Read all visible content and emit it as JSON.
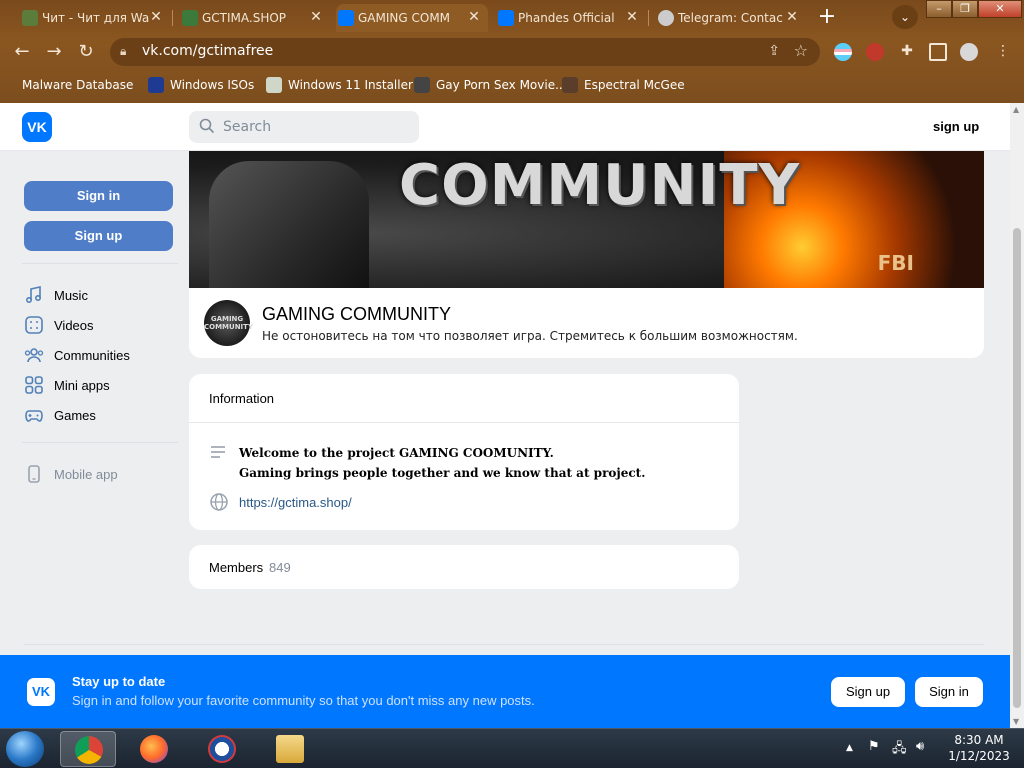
{
  "browser": {
    "tabs": [
      {
        "label": "Чит - Чит для Wa",
        "icon_color": "#5b7c3a"
      },
      {
        "label": "GCTIMA.SHOP",
        "icon_color": "#3c7a3c"
      },
      {
        "label": "GAMING COMM",
        "icon_color": "#0077ff"
      },
      {
        "label": "Phandes Official",
        "icon_color": "#0077ff"
      },
      {
        "label": "Telegram: Contac",
        "icon_color": "#cccccc"
      }
    ],
    "active_tab_index": 2,
    "url": "vk.com/gctimafree",
    "bookmarks": [
      {
        "label": "Malware Database"
      },
      {
        "label": "Windows ISOs"
      },
      {
        "label": "Windows 11 Installer"
      },
      {
        "label": "Gay Porn Sex Movie..."
      },
      {
        "label": "Espectral McGee"
      }
    ]
  },
  "header": {
    "logo": "VK",
    "search_placeholder": "Search",
    "signup_label": "sign up"
  },
  "leftnav": {
    "signin_label": "Sign in",
    "signup_label": "Sign up",
    "items": [
      {
        "label": "Music",
        "icon": "music-icon"
      },
      {
        "label": "Videos",
        "icon": "videos-icon"
      },
      {
        "label": "Communities",
        "icon": "communities-icon"
      },
      {
        "label": "Mini apps",
        "icon": "mini-apps-icon"
      },
      {
        "label": "Games",
        "icon": "games-icon"
      }
    ],
    "mobile_label": "Mobile app"
  },
  "cover": {
    "title": "COMMUNITY",
    "badge": "FBI"
  },
  "group": {
    "avatar_text": "GAMING COMMUNITY",
    "name": "GAMING COMMUNITY",
    "status": "Не остоновитесь на том что позволяет игра. Стремитесь к большим возможностям."
  },
  "information": {
    "title": "Information",
    "desc_line1": "Welcome to the project GAMING COOMUNITY.",
    "desc_line2": "Gaming brings people together and we know that at project.",
    "link": "https://gctima.shop/"
  },
  "members": {
    "label": "Members",
    "count": "849"
  },
  "banner": {
    "logo": "VK",
    "title": "Stay up to date",
    "subtitle": "Sign in and follow your favorite community so that you don't miss any new posts.",
    "signup_label": "Sign up",
    "signin_label": "Sign in"
  },
  "taskbar": {
    "time": "8:30 AM",
    "date": "1/12/2023"
  },
  "colors": {
    "vk_blue": "#0077ff",
    "button_blue": "#4f7dc7",
    "chrome_brown": "#7a4a1c"
  }
}
